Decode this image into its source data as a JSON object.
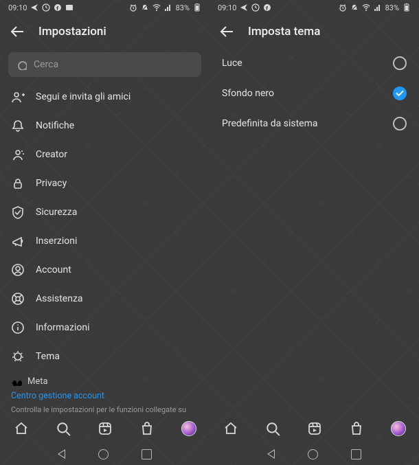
{
  "status": {
    "time": "09:10",
    "battery": "83%"
  },
  "left": {
    "title": "Impostazioni",
    "search_placeholder": "Cerca",
    "items": [
      {
        "key": "follow",
        "label": "Segui e invita gli amici"
      },
      {
        "key": "notify",
        "label": "Notifiche"
      },
      {
        "key": "creator",
        "label": "Creator"
      },
      {
        "key": "privacy",
        "label": "Privacy"
      },
      {
        "key": "security",
        "label": "Sicurezza"
      },
      {
        "key": "ads",
        "label": "Inserzioni"
      },
      {
        "key": "account",
        "label": "Account"
      },
      {
        "key": "help",
        "label": "Assistenza"
      },
      {
        "key": "info",
        "label": "Informazioni"
      },
      {
        "key": "theme",
        "label": "Tema"
      }
    ],
    "meta_section": "Meta",
    "meta_link": "Centro gestione account",
    "footnote": "Controlla le impostazioni per le funzioni collegate su"
  },
  "right": {
    "title": "Imposta tema",
    "options": [
      {
        "label": "Luce",
        "selected": false
      },
      {
        "label": "Sfondo nero",
        "selected": true
      },
      {
        "label": "Predefinita da sistema",
        "selected": false
      }
    ]
  }
}
